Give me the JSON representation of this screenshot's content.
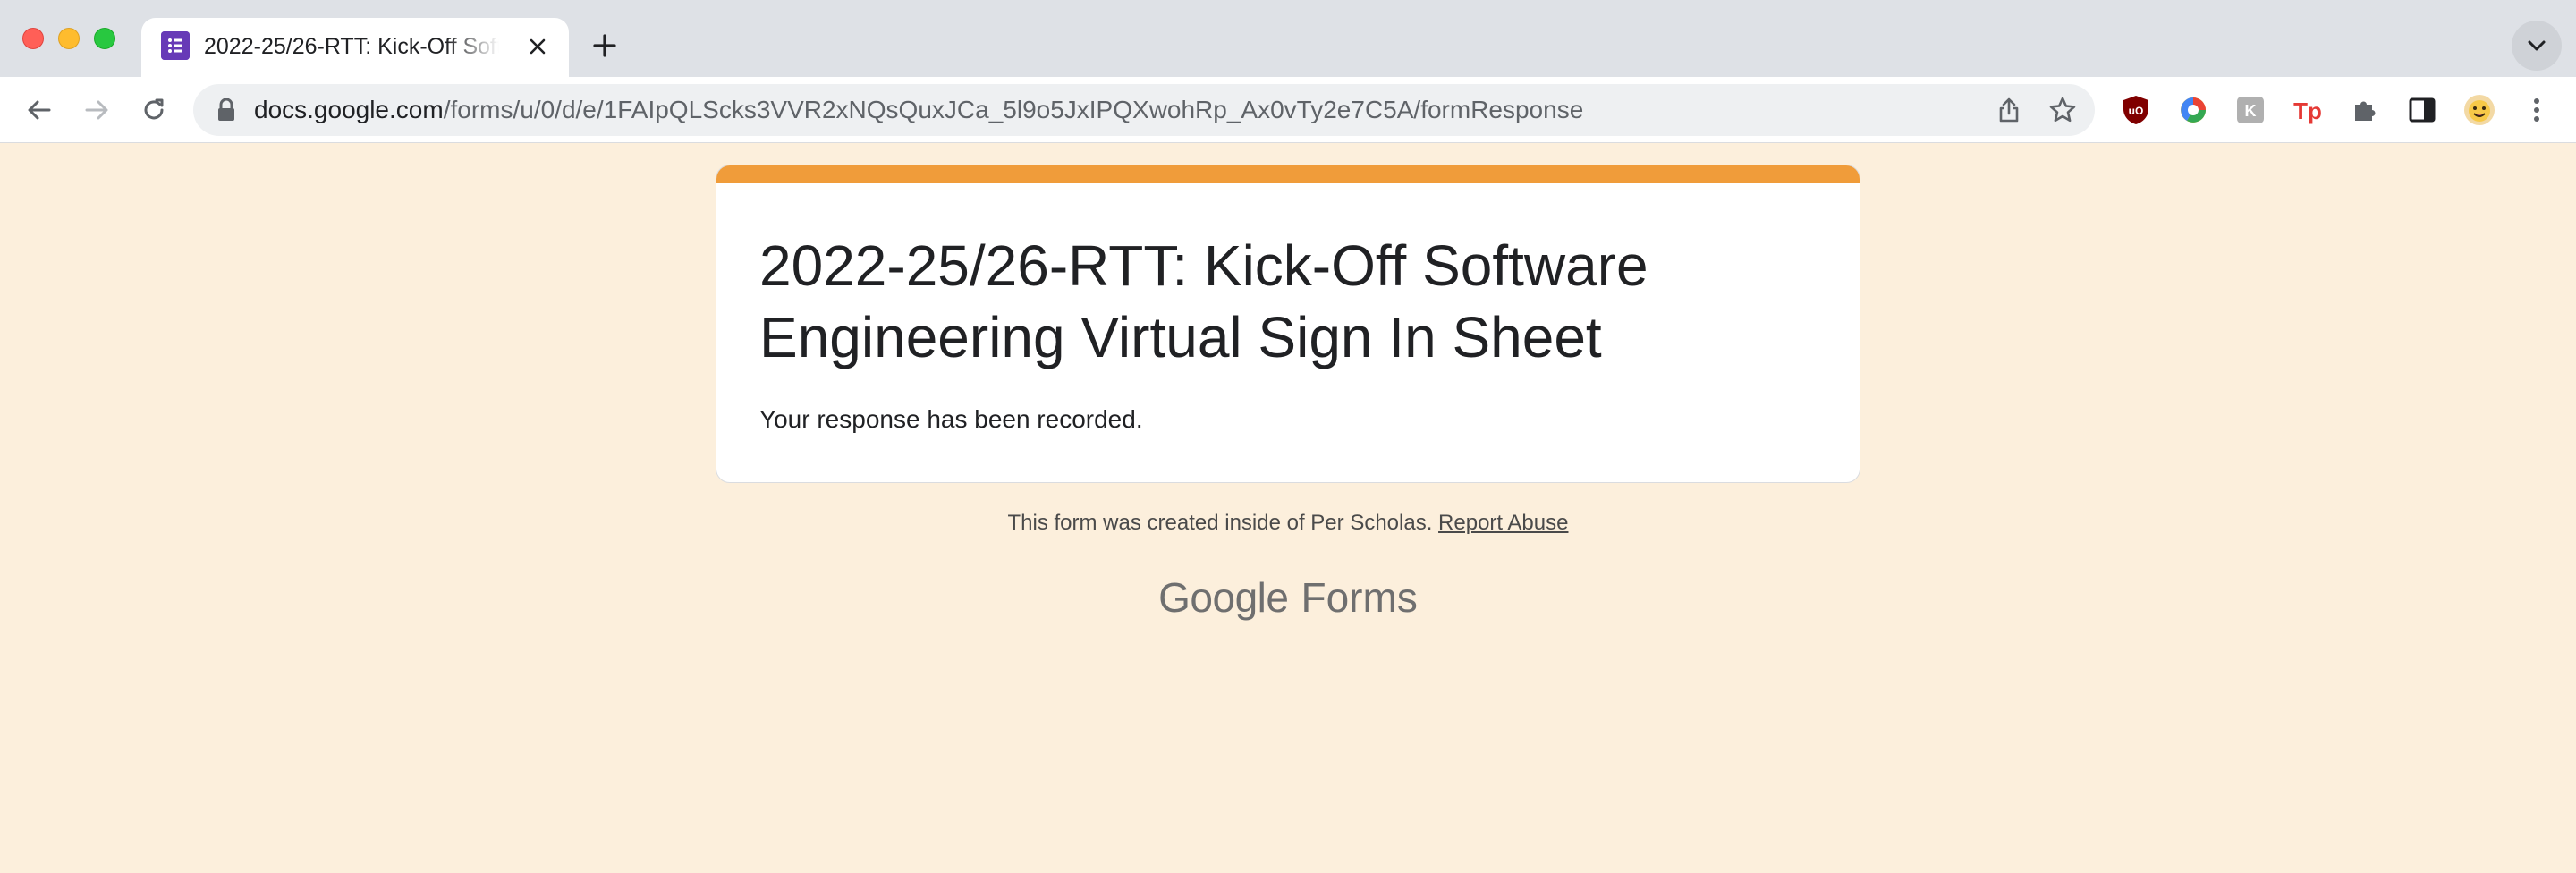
{
  "browser": {
    "tab": {
      "title": "2022-25/26-RTT: Kick-Off Software Engineering Virtual Sign In Sheet",
      "favicon": "google-forms-icon"
    },
    "url": {
      "host": "docs.google.com",
      "path": "/forms/u/0/d/e/1FAIpQLScks3VVR2xNQsQuxJCa_5l9o5JxIPQXwohRp_Ax0vTy2e7C5A/formResponse"
    },
    "extensions": [
      "ublock-icon",
      "chrome-color-icon",
      "k-extension-icon",
      "tp-extension-icon",
      "puzzle-extensions-icon",
      "side-panel-icon",
      "profile-avatar"
    ]
  },
  "form": {
    "title": "2022-25/26-RTT: Kick-Off Software Engineering Virtual Sign In Sheet",
    "message": "Your response has been recorded.",
    "accent_color": "#f09c3a",
    "background_color": "#fcefdc"
  },
  "footer": {
    "note": "This form was created inside of Per Scholas.",
    "report_link": "Report Abuse",
    "brand_google": "Google",
    "brand_forms": "Forms"
  }
}
